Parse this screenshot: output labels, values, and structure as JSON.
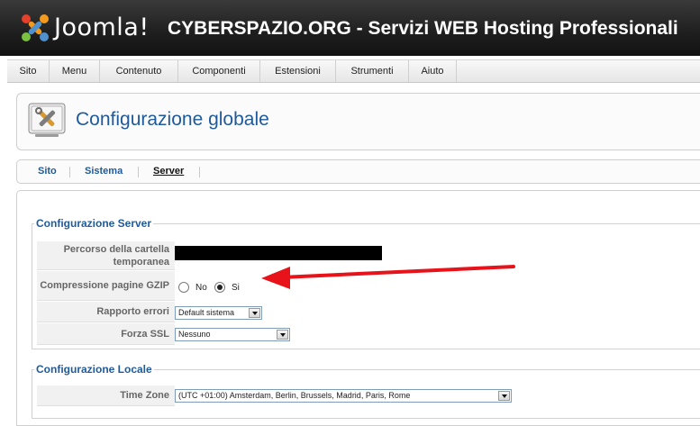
{
  "header": {
    "brand": "Joomla!",
    "site_title": "CYBERSPAZIO.ORG - Servizi WEB Hosting Professionali"
  },
  "menu": [
    "Sito",
    "Menu",
    "Contenuto",
    "Componenti",
    "Estensioni",
    "Strumenti",
    "Aiuto"
  ],
  "page": {
    "title": "Configurazione globale",
    "icon": "configuration-tools-icon"
  },
  "submenu": {
    "items": [
      "Sito",
      "Sistema",
      "Server"
    ],
    "active": "Server"
  },
  "server_section": {
    "legend": "Configurazione Server",
    "temp_path_label": "Percorso della cartella temporanea",
    "gzip_label": "Compressione pagine GZIP",
    "gzip_no": "No",
    "gzip_si": "Si",
    "gzip_selected": "Si",
    "error_report_label": "Rapporto errori",
    "error_report_value": "Default sistema",
    "ssl_label": "Forza SSL",
    "ssl_value": "Nessuno"
  },
  "locale_section": {
    "legend": "Configurazione Locale",
    "timezone_label": "Time Zone",
    "timezone_value": "(UTC +01:00) Amsterdam, Berlin, Brussels, Madrid, Paris, Rome"
  },
  "colors": {
    "accent": "#1f5a9c",
    "annotation_arrow": "#e8121a",
    "header_bg": "#1e1e1e"
  }
}
